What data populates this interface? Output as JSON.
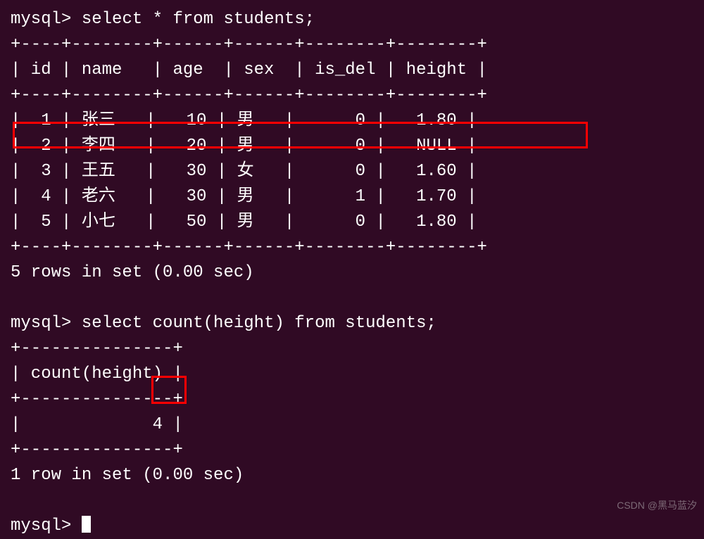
{
  "terminal": {
    "prompt": "mysql>",
    "query1": "select * from students;",
    "table1": {
      "border_top": "+----+--------+------+------+--------+--------+",
      "header": "| id | name   | age  | sex  | is_del | height |",
      "border_mid": "+----+--------+------+------+--------+--------+",
      "rows": [
        "|  1 | 张三   |   10 | 男   |      0 |   1.80 |",
        "|  2 | 李四   |   20 | 男   |      0 |   NULL |",
        "|  3 | 王五   |   30 | 女   |      0 |   1.60 |",
        "|  4 | 老六   |   30 | 男   |      1 |   1.70 |",
        "|  5 | 小七   |   50 | 男   |      0 |   1.80 |"
      ],
      "border_bot": "+----+--------+------+------+--------+--------+",
      "result": "5 rows in set (0.00 sec)"
    },
    "query2": "select count(height) from students;",
    "table2": {
      "border_top": "+---------------+",
      "header": "| count(height) |",
      "border_mid": "+---------------+",
      "row": "|             4 |",
      "border_bot": "+---------------+",
      "result": "1 row in set (0.00 sec)"
    }
  },
  "watermark": "CSDN @黑马蓝汐"
}
